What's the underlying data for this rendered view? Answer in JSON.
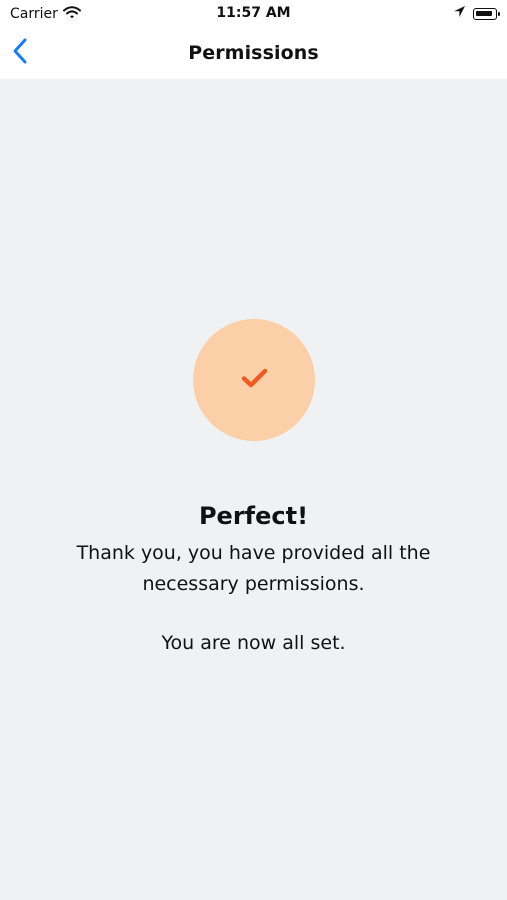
{
  "status_bar": {
    "carrier": "Carrier",
    "time": "11:57 AM",
    "battery_level": 0.92,
    "icons": [
      "wifi-icon",
      "location-arrow-icon",
      "battery-icon"
    ]
  },
  "navigation": {
    "title": "Permissions",
    "back_icon": "chevron-left-icon"
  },
  "content": {
    "status_icon": "checkmark-icon",
    "heading": "Perfect!",
    "message_primary": "Thank you, you have provided all the necessary permissions.",
    "message_secondary": "You are now all set."
  },
  "colors": {
    "accent_blue": "#1a7cf4",
    "success_circle": "#fbcfa7",
    "checkmark": "#ee5a21",
    "background": "#f0f1f3",
    "text": "#111111"
  }
}
